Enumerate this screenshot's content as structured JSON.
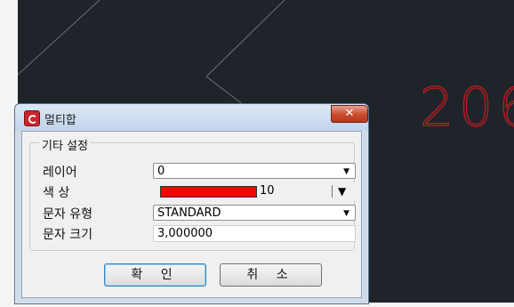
{
  "canvas": {
    "cad_text": "206",
    "background": "#1f242b",
    "line_color": "#6a6f75",
    "text_color": "#c11c1c"
  },
  "dialog": {
    "title": "멀티합",
    "close_label": "✕",
    "group_title": "기타 설정",
    "layer": {
      "label": "레이어",
      "value": "0"
    },
    "color": {
      "label": "색 상",
      "value": "10",
      "swatch": "#ff0000"
    },
    "text_style": {
      "label": "문자 유형",
      "value": "STANDARD"
    },
    "text_size": {
      "label": "문자 크기",
      "value": "3,000000"
    },
    "ok_label": "확 인",
    "cancel_label": "취 소"
  }
}
